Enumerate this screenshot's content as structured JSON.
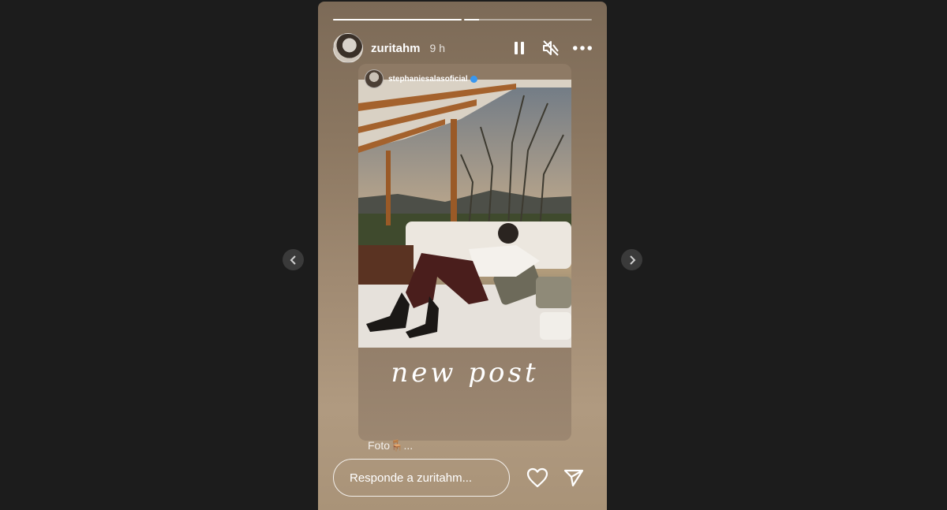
{
  "story": {
    "progress": [
      1.0,
      0.12
    ],
    "user": {
      "username": "zuritahm",
      "time": "9 h"
    },
    "controls": {
      "pause": "pause-icon",
      "mute": "muted-speaker-icon",
      "more": "more-options-icon"
    },
    "shared_post": {
      "username": "stephaniesalasoficial",
      "verified": true,
      "tagline": "new post"
    },
    "caption": "Foto🪑...",
    "reply": {
      "placeholder": "Responde a zuritahm..."
    },
    "footer": {
      "like": "heart-icon",
      "share": "send-icon"
    }
  },
  "navigation": {
    "prev": "chevron-left-icon",
    "next": "chevron-right-icon"
  },
  "colors": {
    "background": "#1c1c1c",
    "text": "#ffffff",
    "verified": "#3897f0"
  }
}
